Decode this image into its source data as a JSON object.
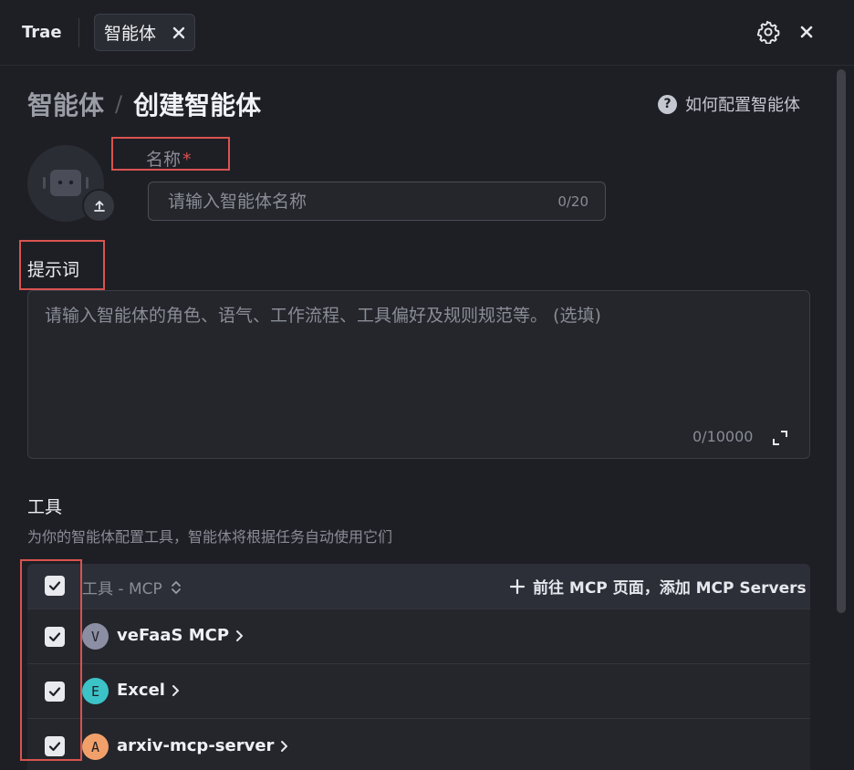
{
  "topbar": {
    "app_name": "Trae",
    "tab_label": "智能体"
  },
  "breadcrumb": {
    "parent": "智能体",
    "separator": "/",
    "current": "创建智能体"
  },
  "help": {
    "icon": "question-circle-icon",
    "label": "如何配置智能体"
  },
  "avatar": {
    "icon": "robot-icon",
    "upload_icon": "upload-icon"
  },
  "name_field": {
    "label": "名称",
    "required_mark": "*",
    "placeholder": "请输入智能体名称",
    "value": "",
    "counter": "0/20"
  },
  "prompt_field": {
    "label": "提示词",
    "placeholder": "请输入智能体的角色、语气、工作流程、工具偏好及规则规范等。 (选填)",
    "value": "",
    "counter": "0/10000"
  },
  "tools": {
    "title": "工具",
    "description": "为你的智能体配置工具，智能体将根据任务自动使用它们",
    "header_label": "工具 - MCP",
    "add_link": "前往 MCP 页面，添加 MCP Servers",
    "items": [
      {
        "initial": "V",
        "name": "veFaaS MCP",
        "color": "#8c8fa3",
        "checked": true
      },
      {
        "initial": "E",
        "name": "Excel",
        "color": "#3cc3c8",
        "checked": true
      },
      {
        "initial": "A",
        "name": "arxiv-mcp-server",
        "color": "#f2a06a",
        "checked": true
      }
    ]
  },
  "colors": {
    "background": "#1e1f25",
    "highlight": "#d9534f",
    "required": "#d9534f"
  }
}
